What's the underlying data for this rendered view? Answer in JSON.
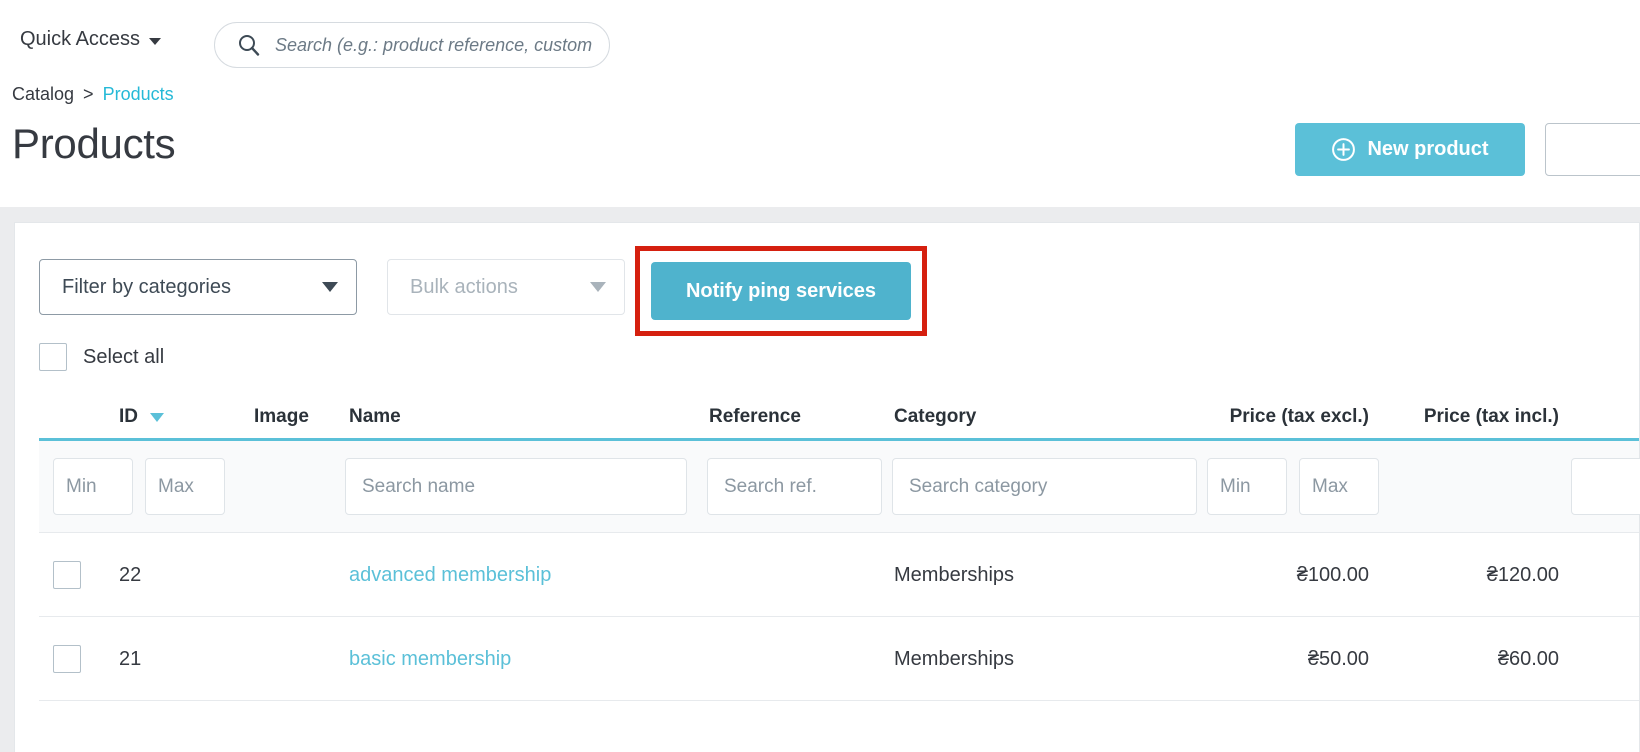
{
  "topbar": {
    "quick_access_label": "Quick Access",
    "quick_access_icon": "caret-down-icon",
    "search_icon": "search-icon",
    "search_placeholder": "Search (e.g.: product reference, custom",
    "search_value": ""
  },
  "breadcrumb": {
    "parent": "Catalog",
    "separator": ">",
    "current": "Products"
  },
  "header": {
    "title": "Products",
    "new_product_label": "New product",
    "new_product_icon": "plus-circle-icon",
    "new_product_color": "#5bc0d8",
    "secondary_button_label": ""
  },
  "toolbar": {
    "filter_categories_label": "Filter by categories",
    "filter_categories_icon": "chevron-down-icon",
    "bulk_actions_label": "Bulk actions",
    "bulk_actions_icon": "chevron-down-icon",
    "notify_label": "Notify ping services",
    "notify_color": "#4fb3cd",
    "highlight_color": "#d5200f"
  },
  "select_all": {
    "label": "Select all",
    "checked": false
  },
  "table": {
    "columns": [
      {
        "key": "checkbox",
        "label": ""
      },
      {
        "key": "id",
        "label": "ID",
        "sort_icon": "chevron-down-icon"
      },
      {
        "key": "image",
        "label": "Image"
      },
      {
        "key": "name",
        "label": "Name"
      },
      {
        "key": "reference",
        "label": "Reference"
      },
      {
        "key": "category",
        "label": "Category"
      },
      {
        "key": "price_excl",
        "label": "Price (tax excl.)"
      },
      {
        "key": "price_incl",
        "label": "Price (tax incl.)"
      }
    ],
    "filters": {
      "id_min_placeholder": "Min",
      "id_max_placeholder": "Max",
      "name_placeholder": "Search name",
      "reference_placeholder": "Search ref.",
      "category_placeholder": "Search category",
      "price_excl_min_placeholder": "Min",
      "price_excl_max_placeholder": "Max",
      "id_min_value": "",
      "id_max_value": "",
      "name_value": "",
      "reference_value": "",
      "category_value": "",
      "price_excl_min_value": "",
      "price_excl_max_value": ""
    },
    "rows": [
      {
        "id": "22",
        "image": "",
        "name": "advanced membership",
        "reference": "",
        "category": "Memberships",
        "price_excl": "₴100.00",
        "price_incl": "₴120.00",
        "checked": false
      },
      {
        "id": "21",
        "image": "",
        "name": "basic membership",
        "reference": "",
        "category": "Memberships",
        "price_excl": "₴50.00",
        "price_incl": "₴60.00",
        "checked": false
      }
    ]
  }
}
